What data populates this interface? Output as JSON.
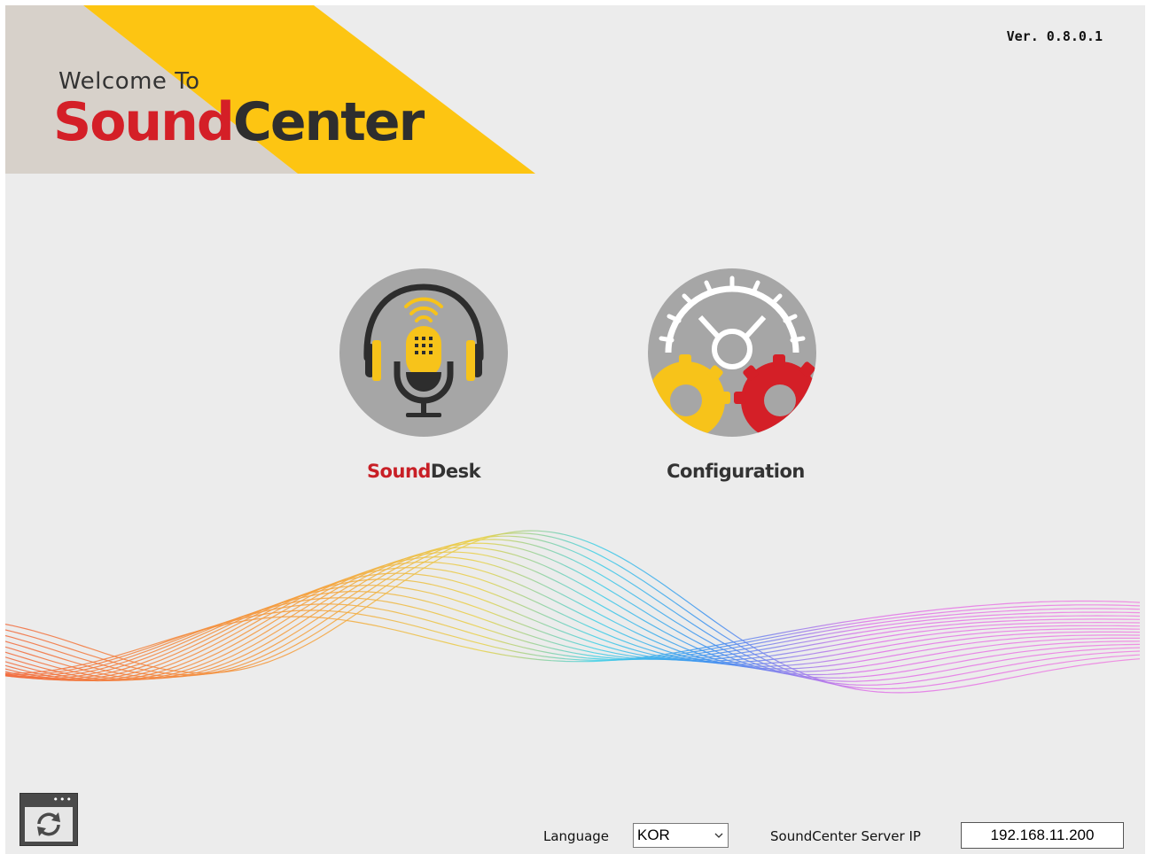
{
  "header": {
    "welcome": "Welcome To",
    "brand_part1": "Sound",
    "brand_part2": "Center",
    "version": "Ver. 0.8.0.1"
  },
  "tiles": [
    {
      "label_part1": "Sound",
      "label_part2": "Desk",
      "icon": "microphone-headphones-icon"
    },
    {
      "label": "Configuration",
      "icon": "gears-icon"
    }
  ],
  "footer": {
    "refresh_icon": "refresh-window-icon",
    "language_label": "Language",
    "language_value": "KOR",
    "server_ip_label": "SoundCenter Server IP",
    "server_ip_value": "192.168.11.200"
  },
  "colors": {
    "background": "#ececec",
    "brand_yellow": "#fdc512",
    "brand_beige": "#d7d1ca",
    "brand_red": "#d41f27",
    "icon_gray": "#a6a6a6"
  }
}
